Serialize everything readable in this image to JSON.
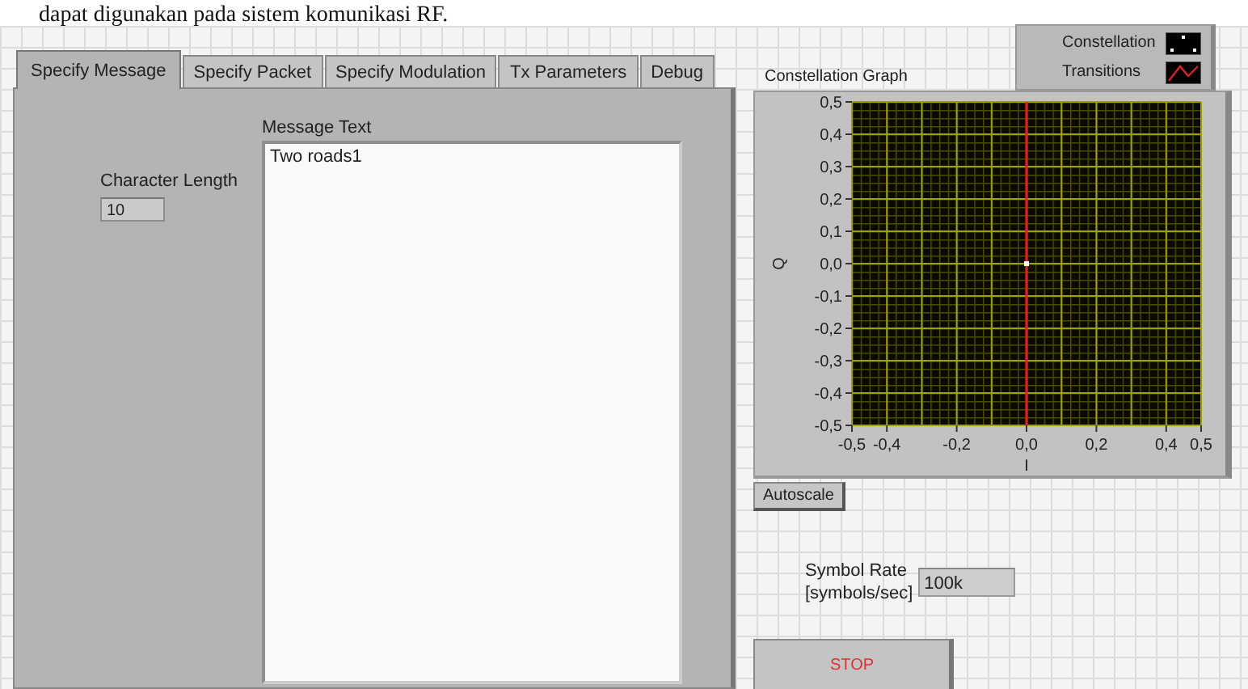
{
  "document_text": "dapat digunakan pada sistem komunikasi RF.",
  "tabs": [
    {
      "label": "Specify Message",
      "selected": true
    },
    {
      "label": "Specify Packet",
      "selected": false
    },
    {
      "label": "Specify Modulation",
      "selected": false
    },
    {
      "label": "Tx Parameters",
      "selected": false
    },
    {
      "label": "Debug",
      "selected": false
    }
  ],
  "message_tab": {
    "character_length": {
      "label": "Character Length",
      "value": "10"
    },
    "message_text": {
      "label": "Message Text",
      "value": "Two roads1"
    }
  },
  "constellation_graph": {
    "chart_data": {
      "type": "scatter",
      "title": "Constellation Graph",
      "xlabel": "I",
      "ylabel": "Q",
      "x": [
        0,
        0
      ],
      "series": [
        {
          "name": "Constellation",
          "type": "scatter",
          "color": "#ffffff",
          "values": [
            0,
            null
          ]
        },
        {
          "name": "Transitions",
          "type": "line",
          "color": "#e02020",
          "values": [
            0.5,
            -0.5
          ]
        }
      ],
      "grid": true,
      "xlim": [
        -0.5,
        0.5
      ],
      "ylim": [
        -0.5,
        0.5
      ],
      "xticks": [
        {
          "value": -0.5,
          "label": "-0,5"
        },
        {
          "value": -0.4,
          "label": "-0,4"
        },
        {
          "value": -0.2,
          "label": "-0,2"
        },
        {
          "value": 0,
          "label": "0,0"
        },
        {
          "value": 0.2,
          "label": "0,2"
        },
        {
          "value": 0.4,
          "label": "0,4"
        },
        {
          "value": 0.5,
          "label": "0,5"
        }
      ],
      "yticks": [
        {
          "value": 0.5,
          "label": "0,5"
        },
        {
          "value": 0.4,
          "label": "0,4"
        },
        {
          "value": 0.3,
          "label": "0,3"
        },
        {
          "value": 0.2,
          "label": "0,2"
        },
        {
          "value": 0.1,
          "label": "0,1"
        },
        {
          "value": 0,
          "label": "0,0"
        },
        {
          "value": -0.1,
          "label": "-0,1"
        },
        {
          "value": -0.2,
          "label": "-0,2"
        },
        {
          "value": -0.3,
          "label": "-0,3"
        },
        {
          "value": -0.4,
          "label": "-0,4"
        },
        {
          "value": -0.5,
          "label": "-0,5"
        }
      ]
    }
  },
  "autoscale_button": "Autoscale",
  "symbol_rate": {
    "label": "Symbol Rate\n[symbols/sec]",
    "value": "100k"
  },
  "stop_button": "STOP"
}
